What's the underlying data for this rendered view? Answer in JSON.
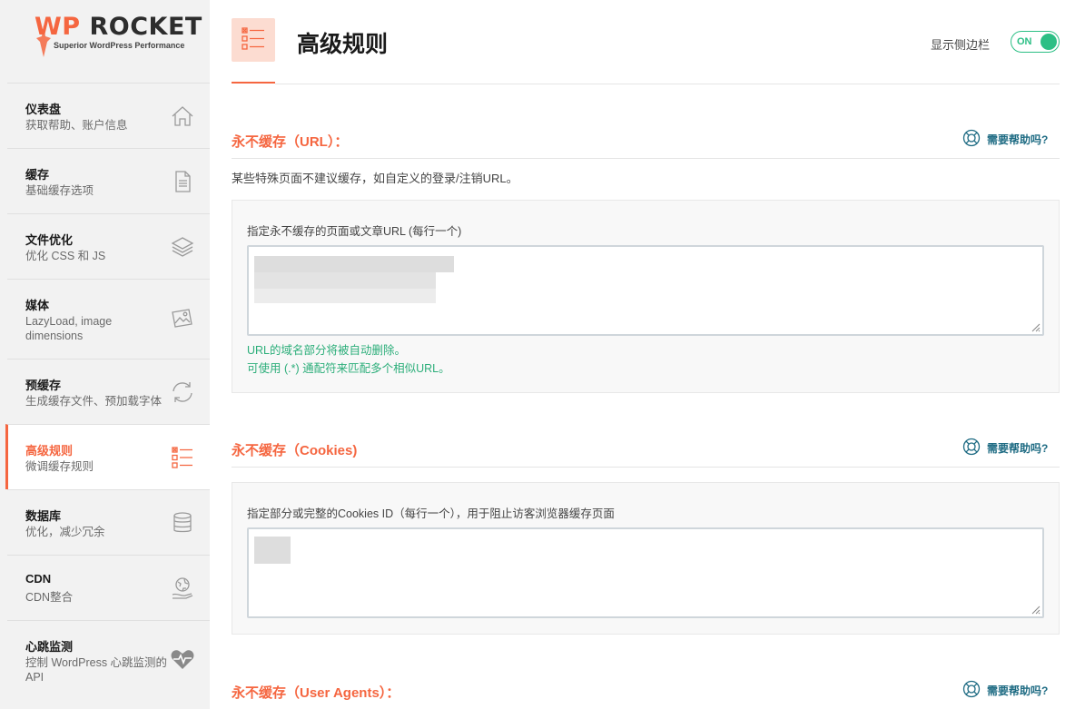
{
  "brand": {
    "name_wp": "WP",
    "name_rocket": "ROCKET",
    "tagline": "Superior WordPress Performance",
    "accent_color": "#f56640",
    "success_color": "#2cbf85",
    "link_color": "#1e6b83"
  },
  "sidebar": {
    "items": [
      {
        "title": "仪表盘",
        "subtitle": "获取帮助、账户信息",
        "icon": "home-icon",
        "active": false
      },
      {
        "title": "缓存",
        "subtitle": "基础缓存选项",
        "icon": "file-icon",
        "active": false
      },
      {
        "title": "文件优化",
        "subtitle": "优化 CSS 和 JS",
        "icon": "layers-icon",
        "active": false
      },
      {
        "title": "媒体",
        "subtitle": "LazyLoad, image dimensions",
        "icon": "images-icon",
        "active": false
      },
      {
        "title": "预缓存",
        "subtitle": "生成缓存文件、预加载字体",
        "icon": "refresh-icon",
        "active": false
      },
      {
        "title": "高级规则",
        "subtitle": "微调缓存规则",
        "icon": "checklist-icon",
        "active": true
      },
      {
        "title": "数据库",
        "subtitle": "优化，减少冗余",
        "icon": "database-icon",
        "active": false
      },
      {
        "title": "CDN",
        "subtitle": "CDN整合",
        "icon": "globe-hand-icon",
        "active": false
      },
      {
        "title": "心跳监测",
        "subtitle": "控制 WordPress 心跳监测的 API",
        "icon": "heartbeat-icon",
        "active": false
      }
    ]
  },
  "header": {
    "title": "高级规则",
    "icon": "checklist-icon",
    "sidebar_toggle_label": "显示侧边栏",
    "sidebar_toggle_state": "ON"
  },
  "sections": {
    "urls": {
      "title": "永不缓存（URL）：",
      "help": "需要帮助吗?",
      "description": "某些特殊页面不建议缓存，如自定义的登录/注销URL。",
      "field_label": "指定永不缓存的页面或文章URL (每行一个)",
      "hint_1": "URL的域名部分将被自动删除。",
      "hint_2": "可使用 (.*) 通配符来匹配多个相似URL。"
    },
    "cookies": {
      "title": "永不缓存（Cookies)",
      "help": "需要帮助吗?",
      "field_label": "指定部分或完整的Cookies ID（每行一个），用于阻止访客浏览器缓存页面"
    },
    "user_agents": {
      "title": "永不缓存（User Agents）：",
      "help": "需要帮助吗?"
    }
  }
}
